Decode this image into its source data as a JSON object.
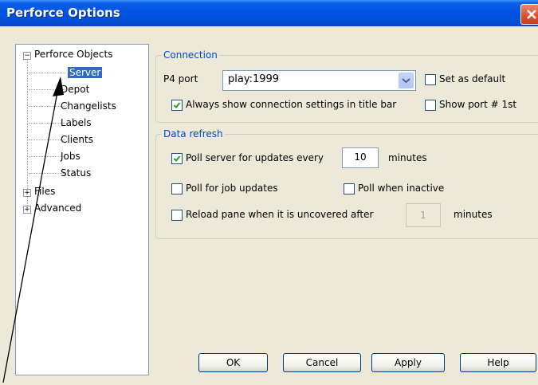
{
  "window": {
    "title": "Perforce Options"
  },
  "tree": {
    "root": "Perforce Objects",
    "children": [
      "Server",
      "Depot",
      "Changelists",
      "Labels",
      "Clients",
      "Jobs",
      "Status"
    ],
    "others": [
      "Files",
      "Advanced"
    ],
    "selected": "Server"
  },
  "connection": {
    "title": "Connection",
    "port_label": "P4 port",
    "port_value": "play:1999",
    "set_default": "Set as default",
    "always_show": "Always show connection settings in title bar",
    "show_port": "Show port # 1st",
    "always_show_checked": true,
    "set_default_checked": false,
    "show_port_checked": false
  },
  "refresh": {
    "title": "Data refresh",
    "poll_server": "Poll server for updates every",
    "poll_value": "10",
    "minutes": "minutes",
    "poll_jobs": "Poll for job updates",
    "poll_inactive": "Poll when inactive",
    "reload": "Reload pane when it is uncovered after",
    "reload_value": "1",
    "reload_minutes": "minutes",
    "poll_server_checked": true
  },
  "buttons": {
    "ok": "OK",
    "cancel": "Cancel",
    "apply": "Apply",
    "help": "Help"
  }
}
